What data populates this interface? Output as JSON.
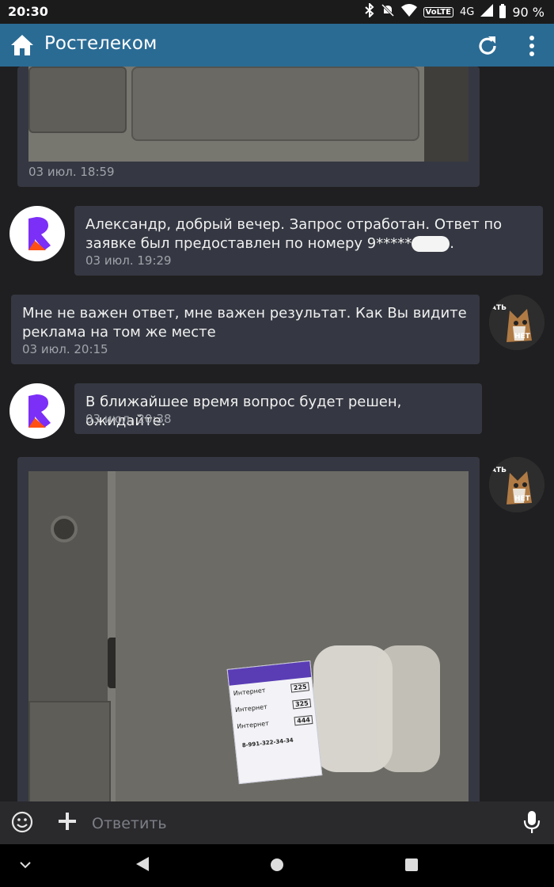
{
  "status_bar": {
    "time": "20:30",
    "network": "4G",
    "volte": "VoLTE",
    "battery": "90 %"
  },
  "app_bar": {
    "title": "Ростелеком"
  },
  "messages": [
    {
      "time": "03 июл. 18:59"
    },
    {
      "text_line1": "Александр, добрый вечер. Запрос отработан. Ответ по",
      "text_line2": "заявке был предоставлен по номеру 9*****",
      "text_end": ".",
      "time": "03 июл. 19:29"
    },
    {
      "text_line1": "Мне не важен ответ, мне важен результат. Как Вы видите",
      "text_line2": "реклама на том же месте",
      "time": "03 июл. 20:15"
    },
    {
      "text_line1": "В ближайшее время вопрос будет решен, ожидайте.",
      "time": "03 июл. 20:38"
    }
  ],
  "avatar_text": {
    "top": "АТЬ",
    "bottom": "НЕТ"
  },
  "poster": {
    "rows": [
      {
        "label": "Интернет",
        "price": "225"
      },
      {
        "label": "Интернет",
        "price": "325"
      },
      {
        "label": "Интернет",
        "price": "444"
      }
    ],
    "phone": "8-991-322-34-34"
  },
  "input": {
    "placeholder": "Ответить"
  },
  "colors": {
    "app_bar": "#2a6b94",
    "bubble": "#353842",
    "background": "#1f1f21",
    "brand": "#7b2ff7"
  }
}
